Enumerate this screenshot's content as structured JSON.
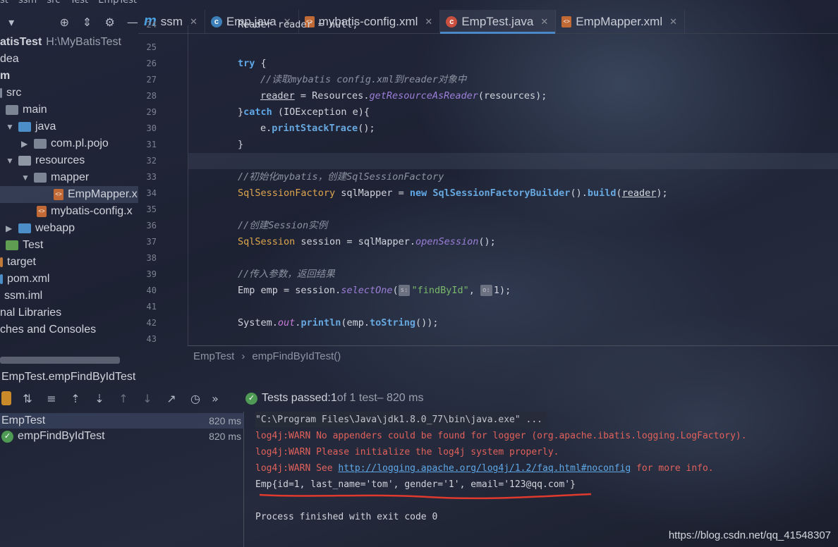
{
  "top_crumbs": [
    "st",
    "ssm",
    "src",
    "Test",
    "EmpTest"
  ],
  "tabs": [
    {
      "label": "ssm",
      "icon": "module-icon"
    },
    {
      "label": "Emp.java",
      "icon": "class-icon"
    },
    {
      "label": "mybatis-config.xml",
      "icon": "xml-icon"
    },
    {
      "label": "EmpTest.java",
      "icon": "test-class-icon"
    },
    {
      "label": "EmpMapper.xml",
      "icon": "xml-icon"
    }
  ],
  "active_tab": "EmpTest.java",
  "tree": {
    "root_label": "atisTest",
    "root_path": "H:\\MyBatisTest",
    "items": [
      {
        "label": "dea"
      },
      {
        "label": "m"
      },
      {
        "label": "src"
      },
      {
        "label": "main"
      },
      {
        "label": "java"
      },
      {
        "label": "com.pl.pojo"
      },
      {
        "label": "resources"
      },
      {
        "label": "mapper"
      },
      {
        "label": "EmpMapper.x"
      },
      {
        "label": "mybatis-config.x"
      },
      {
        "label": "webapp"
      },
      {
        "label": "Test"
      },
      {
        "label": "target"
      },
      {
        "label": "pom.xml"
      },
      {
        "label": "ssm.iml"
      },
      {
        "label": "nal Libraries"
      },
      {
        "label": "ches and Consoles"
      }
    ]
  },
  "line_numbers": [
    "24",
    "25",
    "26",
    "27",
    "28",
    "29",
    "30",
    "31",
    "32",
    "33",
    "34",
    "35",
    "36",
    "37",
    "38",
    "39",
    "40",
    "41",
    "42",
    "43"
  ],
  "code": {
    "l24": "Reader reader = null;",
    "l26_kw": "try",
    "l26_rest": " {",
    "l27": "//读取mybatis config.xml到reader对象中",
    "l28_a": "reader",
    "l28_b": " = Resources.",
    "l28_c": "getResourceAsReader",
    "l28_d": "(resources);",
    "l29_a": "}",
    "l29_b": "catch",
    "l29_c": " (IOException e){",
    "l30_a": "e.",
    "l30_b": "printStackTrace",
    "l30_c": "();",
    "l31": "}",
    "l33": "//初始化mybatis，创建SqlSessionFactory",
    "l34_a": "SqlSessionFactory",
    "l34_b": " sqlMapper = ",
    "l34_c": "new",
    "l34_d": "SqlSessionFactoryBuilder",
    "l34_e": "().",
    "l34_f": "build",
    "l34_g": "(",
    "l34_h": "reader",
    "l34_i": ");",
    "l36": "//创建Session实例",
    "l37_a": "SqlSession",
    "l37_b": " session = sqlMapper.",
    "l37_c": "openSession",
    "l37_d": "();",
    "l39": "//传入参数，返回结果",
    "l40_a": "Emp emp = session.",
    "l40_b": "selectOne",
    "l40_c": "(",
    "l40_hint1": "s:",
    "l40_d": "\"findById\"",
    "l40_e": ", ",
    "l40_hint2": "o:",
    "l40_f": "1);",
    "l42_a": "System.",
    "l42_b": "out",
    "l42_c": ".",
    "l42_d": "println",
    "l42_e": "(emp.",
    "l42_f": "toString",
    "l42_g": "());"
  },
  "editor_breadcrumb": [
    "EmpTest",
    "empFindByIdTest()"
  ],
  "run_header": "EmpTest.empFindByIdTest",
  "tests_status": {
    "prefix": "Tests passed: ",
    "count": "1",
    "suffix": " of 1 test",
    "time": " – 820 ms"
  },
  "test_tree": [
    {
      "label": "EmpTest",
      "time": "820 ms"
    },
    {
      "label": "empFindByIdTest",
      "time": "820 ms"
    }
  ],
  "console": {
    "cmd": "\"C:\\Program Files\\Java\\jdk1.8.0_77\\bin\\java.exe\" ...",
    "warn1": "log4j:WARN No appenders could be found for logger (org.apache.ibatis.logging.LogFactory).",
    "warn2": "log4j:WARN Please initialize the log4j system properly.",
    "warn3_a": "log4j:WARN See ",
    "warn3_link": "http://logging.apache.org/log4j/1.2/faq.html#noconfig",
    "warn3_b": " for more info.",
    "result": "Emp{id=1, last_name='tom', gender='1', email='123@qq.com'}",
    "exit": "Process finished with exit code 0"
  },
  "watermark": "https://blog.csdn.net/qq_41548307"
}
